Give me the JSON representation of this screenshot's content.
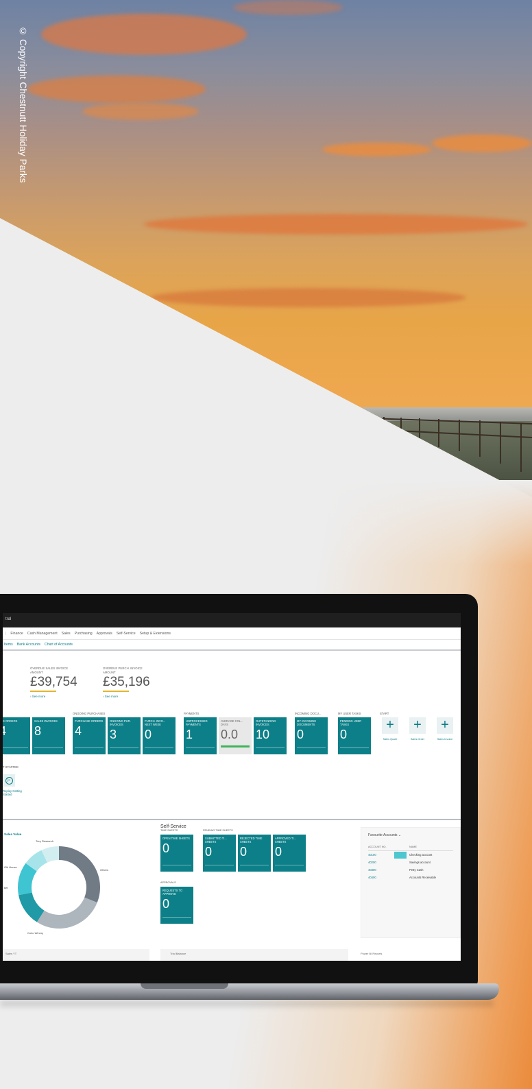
{
  "copyright": "© Copyright Chestnutt Holiday Parks",
  "app": {
    "title": "tral",
    "nav": [
      "Finance",
      "Cash Management",
      "Sales",
      "Purchasing",
      "Approvals",
      "Self-Service",
      "Setup & Extensions"
    ],
    "subnav": [
      "Items",
      "Bank Accounts",
      "Chart of Accounts"
    ]
  },
  "kpis": [
    {
      "label": "OVERDUE SALES INVOICE AMOUNT",
      "value": "£39,754",
      "more": "› See more"
    },
    {
      "label": "OVERDUE PURCH. INVOICE AMOUNT",
      "value": "£35,196",
      "more": "› See more"
    }
  ],
  "activities": [
    {
      "title": "",
      "tiles": [
        {
          "label": "LES ORDERS",
          "value": "4"
        },
        {
          "label": "SALES INVOICES",
          "value": "8"
        }
      ]
    },
    {
      "title": "ONGOING PURCHASES",
      "tiles": [
        {
          "label": "PURCHASE ORDERS",
          "value": "4"
        },
        {
          "label": "ONGOING PUR. INVOICES",
          "value": "3"
        },
        {
          "label": "PURCH. INVO... NEXT WEEK",
          "value": "0"
        }
      ]
    },
    {
      "title": "PAYMENTS",
      "tiles": [
        {
          "label": "UNPROCESSED PAYMENTS",
          "value": "1"
        },
        {
          "label": "AVERAGE COL... DAYS",
          "value": "0.0"
        },
        {
          "label": "OUTSTANDING INVOICES",
          "value": "10"
        }
      ]
    },
    {
      "title": "INCOMING DOCU...",
      "tiles": [
        {
          "label": "MY INCOMING DOCUMENTS",
          "value": "0"
        }
      ]
    },
    {
      "title": "MY USER TASKS",
      "tiles": [
        {
          "label": "PENDING USER TASKS",
          "value": "0"
        }
      ]
    }
  ],
  "start": {
    "title": "START",
    "items": [
      "Sales Quote",
      "Sales Order",
      "Sales Invoice"
    ]
  },
  "get_started": {
    "title": "T STARTED",
    "label": "Replay Getting Started"
  },
  "sales_value": {
    "title": "Sales Value",
    "labels": [
      "Trey Research",
      "Olk House",
      "ket",
      "Coho Winery",
      "Others"
    ],
    "segments": [
      {
        "name": "Others",
        "value": 31,
        "color": "#707b86"
      },
      {
        "name": "Coho Winery",
        "value": 28,
        "color": "#adb5bd"
      },
      {
        "name": "ket",
        "value": 13,
        "color": "#1f9aa6"
      },
      {
        "name": "Olk House",
        "value": 13,
        "color": "#3fc4d1"
      },
      {
        "name": "Trey Research",
        "value": 8,
        "color": "#a7e4ea"
      },
      {
        "name": "",
        "value": 7,
        "color": "#d3eef1"
      }
    ]
  },
  "self_service": {
    "title": "Self-Service",
    "time_sheets_title": "TIME SHEETS",
    "time_sheets": [
      {
        "label": "OPEN TIME SHEETS",
        "value": "0"
      }
    ],
    "pending_title": "PENDING TIME SHEETS",
    "pending": [
      {
        "label": "SUBMITTED TI... SHEETS",
        "value": "0"
      },
      {
        "label": "REJECTED TIME SHEETS",
        "value": "0"
      },
      {
        "label": "APPROVED TI... SHEETS",
        "value": "0"
      }
    ],
    "approvals_title": "APPROVALS",
    "approvals": [
      {
        "label": "REQUESTS TO APPROVE",
        "value": "0"
      }
    ]
  },
  "favourite_accounts": {
    "title": "Favourite Accounts",
    "headers": [
      "ACCOUNT NO.",
      "NAME"
    ],
    "rows": [
      [
        "40100",
        "Checking account"
      ],
      [
        "40200",
        "Savings account"
      ],
      [
        "40300",
        "Petty Cash"
      ],
      [
        "40400",
        "Accounts Receivable"
      ]
    ]
  },
  "bottom": {
    "left": "Sales YT",
    "middle": "Trial Balance",
    "right": "Power BI Reports"
  }
}
